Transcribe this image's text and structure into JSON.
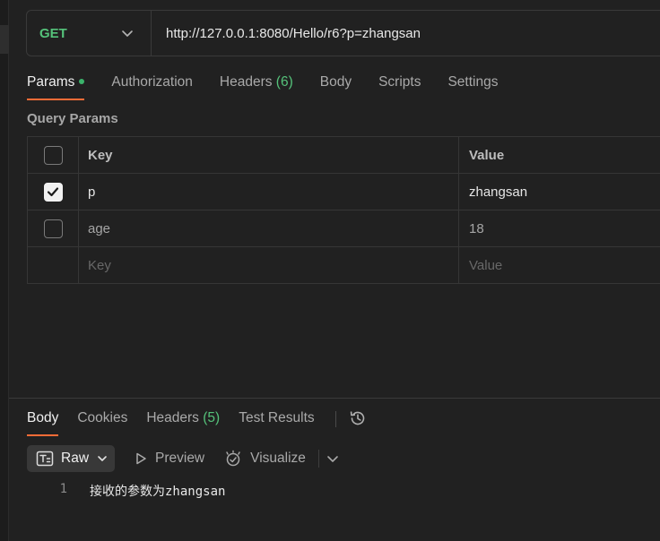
{
  "request": {
    "method": "GET",
    "url": "http://127.0.0.1:8080/Hello/r6?p=zhangsan"
  },
  "request_tabs": [
    {
      "label": "Params",
      "active": true,
      "indicator": "green-dot"
    },
    {
      "label": "Authorization"
    },
    {
      "label": "Headers",
      "count": "(6)"
    },
    {
      "label": "Body"
    },
    {
      "label": "Scripts"
    },
    {
      "label": "Settings"
    }
  ],
  "query_params": {
    "title": "Query Params",
    "headers": {
      "key": "Key",
      "value": "Value"
    },
    "rows": [
      {
        "checked": true,
        "key": "p",
        "value": "zhangsan"
      },
      {
        "checked": false,
        "key": "age",
        "value": "18"
      }
    ],
    "placeholder": {
      "key": "Key",
      "value": "Value"
    }
  },
  "response_tabs": [
    {
      "label": "Body",
      "active": true
    },
    {
      "label": "Cookies"
    },
    {
      "label": "Headers",
      "count": "(5)"
    },
    {
      "label": "Test Results"
    }
  ],
  "response_toolbar": {
    "format": "Raw",
    "preview": "Preview",
    "visualize": "Visualize"
  },
  "response_body": {
    "lines": [
      {
        "number": "1",
        "text": "接收的参数为zhangsan"
      }
    ]
  },
  "colors": {
    "accent": "#ff6c37",
    "method_get": "#55c27a",
    "background": "#212121"
  }
}
